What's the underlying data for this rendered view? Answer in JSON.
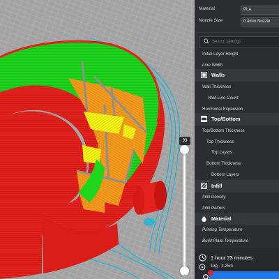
{
  "viewport": {
    "layer_number": "93",
    "layer_fraction": 1.0
  },
  "panel": {
    "material": {
      "label": "Material",
      "value": "PLA"
    },
    "nozzle": {
      "label": "Nozzle Size",
      "value": "0.4mm Nozzle"
    },
    "search": {
      "placeholder": "Search settings"
    },
    "sections": [
      {
        "title": "",
        "items": [
          "Initial Layer Height",
          "Line Width"
        ]
      },
      {
        "title": "Walls",
        "icon": "walls-icon",
        "items": [
          "Wall Thickness",
          "Wall Line Count",
          "Horizontal Expansion"
        ]
      },
      {
        "title": "Top/Bottom",
        "icon": "top-bottom-icon",
        "items": [
          "Top/Bottom Thickness",
          "Top Thickness",
          "Top Layers",
          "Bottom Thickness",
          "Bottom Layers"
        ]
      },
      {
        "title": "Infill",
        "icon": "infill-icon",
        "items": [
          "Infill Density",
          "Infill Pattern"
        ]
      },
      {
        "title": "Material",
        "icon": "material-icon",
        "items": [
          "Printing Temperature",
          "Build Plate Temperature"
        ]
      }
    ]
  },
  "footer": {
    "time": "1 hour 23 minutes",
    "material_usage": "13g · 4.25m"
  },
  "colors": {
    "panel_bg": "#2b2d31",
    "wall_outer": "#e8201c",
    "wall_inner": "#22d61e",
    "infill": "#f39a1e",
    "skin": "#ffff00",
    "travel": "#19b7d6",
    "slice_button": "#1e76e8"
  }
}
